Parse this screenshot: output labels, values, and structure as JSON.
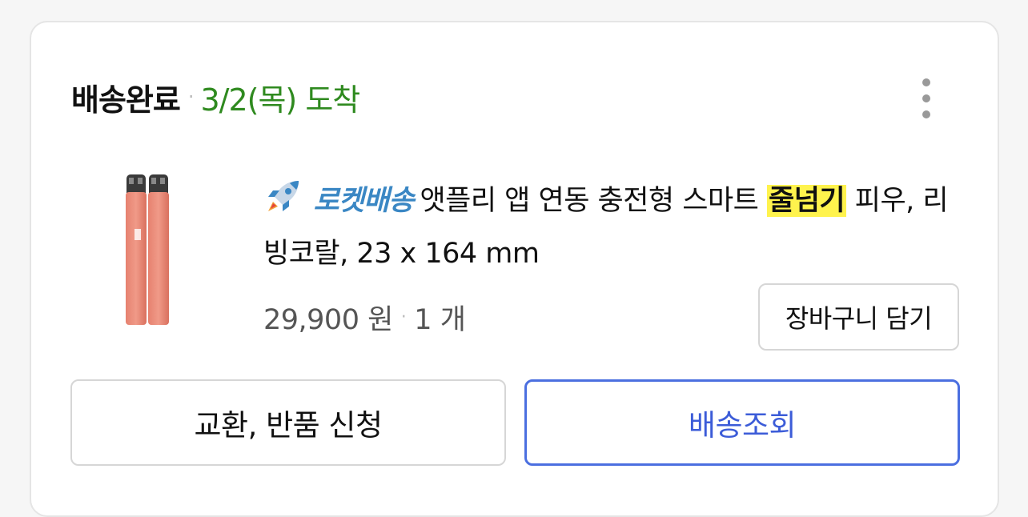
{
  "order": {
    "status": "배송완료",
    "separator": "·",
    "arrival": "3/2(목) 도착",
    "menu_icon": "more-vertical-icon"
  },
  "product": {
    "image_icon": "pink-jump-rope-product-image",
    "badge_icon": "rocket-icon",
    "badge_label": "로켓배송",
    "title_before": "앳플리 앱 연동 충전형 스마트",
    "title_highlight": "줄넘기",
    "title_after": "피우, 리빙코랄, 23 x 164 mm",
    "price": "29,900 원",
    "separator": "·",
    "quantity": "1 개",
    "cart_button": "장바구니 담기"
  },
  "actions": {
    "return_button": "교환, 반품 신청",
    "track_button": "배송조회"
  },
  "colors": {
    "arrival_green": "#2f8a1f",
    "rocket_blue": "#3a87c4",
    "highlight_yellow": "#fff34d",
    "track_blue": "#4b6fe0"
  }
}
